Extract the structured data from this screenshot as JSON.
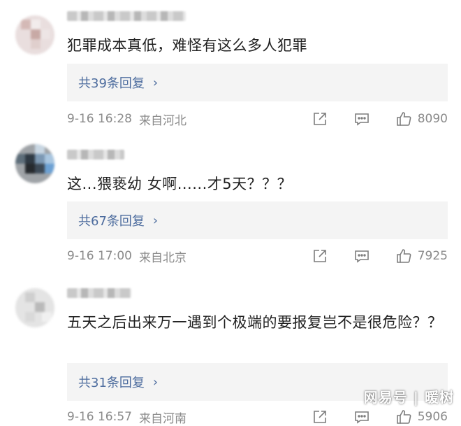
{
  "comments": [
    {
      "text": "犯罪成本真低，难怪有这么多人犯罪",
      "replies_label": "共39条回复",
      "time": "9-16 16:28",
      "location": "来自河北",
      "likes": "8090"
    },
    {
      "text": "这...猥亵幼 女啊......才5天？？？",
      "replies_label": "共67条回复",
      "time": "9-16 17:00",
      "location": "来自北京",
      "likes": "7925"
    },
    {
      "text": "五天之后出来万一遇到个极端的要报复岂不是很危险？？",
      "replies_label": "共31条回复",
      "time": "9-16 16:57",
      "location": "来自河南",
      "likes": "5906"
    }
  ],
  "chevron": "›",
  "watermark": "网易号 | 暖树"
}
